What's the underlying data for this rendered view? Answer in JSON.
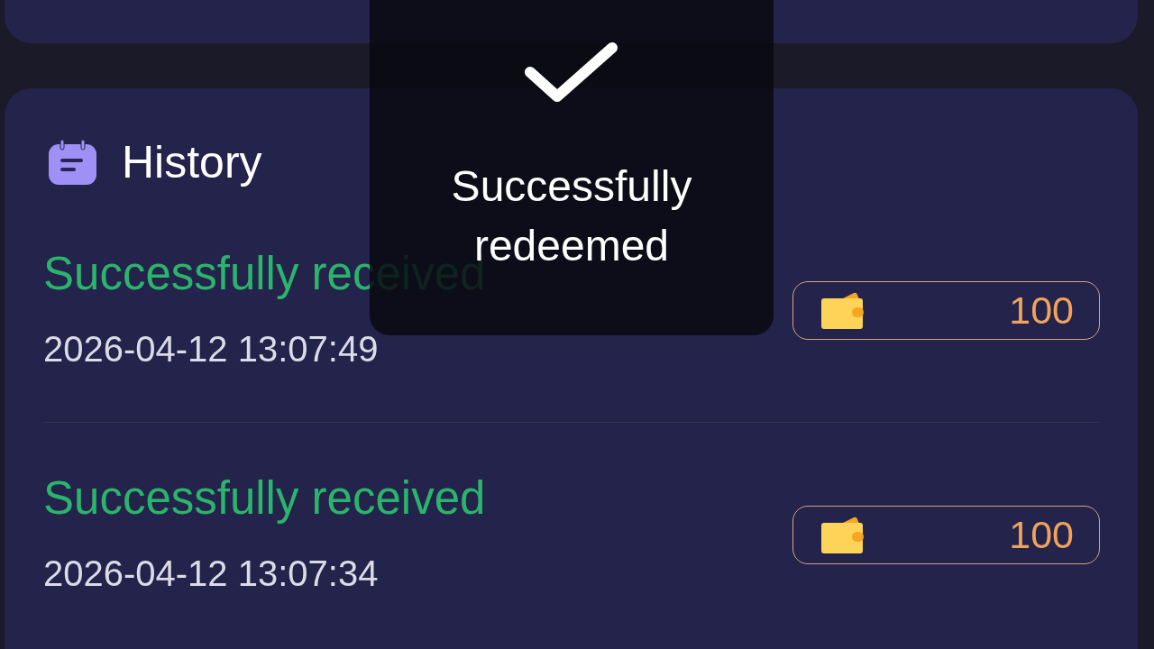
{
  "history": {
    "title": "History",
    "entries": [
      {
        "status": "Successfully received",
        "timestamp": "2026-04-12 13:07:49",
        "amount": "100"
      },
      {
        "status": "Successfully received",
        "timestamp": "2026-04-12 13:07:34",
        "amount": "100"
      }
    ]
  },
  "toast": {
    "message": "Successfully redeemed"
  }
}
